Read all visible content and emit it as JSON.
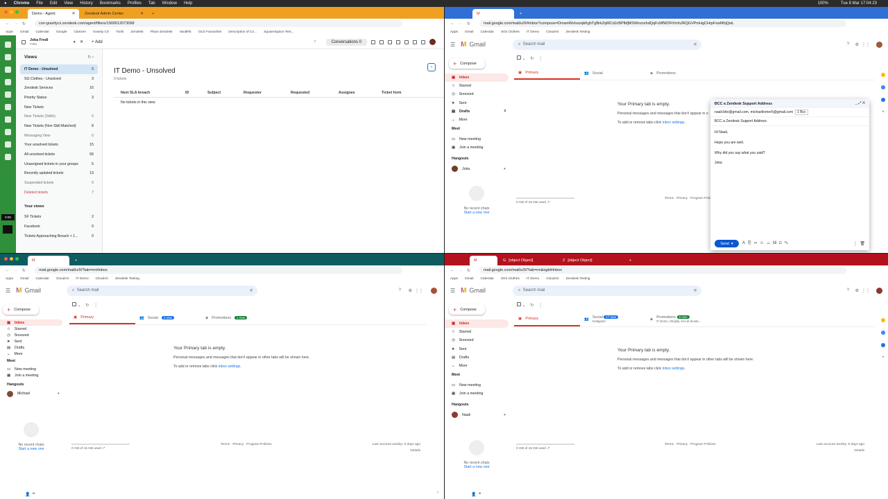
{
  "menubar": {
    "apple": "",
    "app": "Chrome",
    "items": [
      "File",
      "Edit",
      "View",
      "History",
      "Bookmarks",
      "Profiles",
      "Tab",
      "Window",
      "Help"
    ],
    "battery": "100%",
    "clock": "Tue 8 Mar 17:04:23"
  },
  "q1": {
    "tabs": [
      "Demo - Agent",
      "Zendesk Admin Center"
    ],
    "url": "con-gravitycx.zendesk.com/agent/filters/1900012073068",
    "bookmarks": [
      "Apps",
      "Gmail",
      "Calendar",
      "Google",
      "Clarizen",
      "Gravity CX",
      "Tools",
      "Zendesk",
      "Place Zendesk",
      "VaultRE",
      "OLD Favourites",
      "Description of Co...",
      "SquareSpace Test..."
    ],
    "user": {
      "name": "Joka Fredi",
      "id": "#485"
    },
    "add_label": "Add",
    "conversations_label": "Conversations",
    "conversations_count": "0",
    "views_title": "Views",
    "views": [
      {
        "label": "IT Demo - Unsolved",
        "count": "0"
      },
      {
        "label": "SG Clothes - Unsolved",
        "count": "3"
      },
      {
        "label": "Zendesk Services",
        "count": "16"
      },
      {
        "label": "Priority Status",
        "count": "3"
      },
      {
        "label": "New Tickets",
        "count": ""
      },
      {
        "label": "New Tickets (Skills)",
        "count": "0"
      },
      {
        "label": "New Tickets (Non Skill Matched)",
        "count": "8"
      },
      {
        "label": "Messaging View",
        "count": "0"
      },
      {
        "label": "Your unsolved tickets",
        "count": "15"
      },
      {
        "label": "All unsolved tickets",
        "count": "56"
      },
      {
        "label": "Unassigned tickets in your groups",
        "count": "5"
      },
      {
        "label": "Recently updated tickets",
        "count": "13"
      },
      {
        "label": "Suspended tickets",
        "count": "0"
      },
      {
        "label": "Deleted tickets",
        "count": "7"
      }
    ],
    "your_views_title": "Your views",
    "your_views": [
      {
        "label": "SF Tickets",
        "count": "2"
      },
      {
        "label": "Facebook",
        "count": "0"
      },
      {
        "label": "Tickets Approaching Breach < 1...",
        "count": "0"
      }
    ],
    "page_title": "IT Demo - Unsolved",
    "ticket_count": "0 tickets",
    "columns": [
      "Next SLA breach",
      "ID",
      "Subject",
      "Requester",
      "Requested",
      "Assignee",
      "Ticket form"
    ],
    "empty_row": "No tickets in this view",
    "timer": "0:00"
  },
  "q2": {
    "url": "mail.google.com/mail/u/0/#inbox?compose=DmwnWsIvszqkKghTgBrkZqMCdJcBPfbfjMSWnzxxhdQqFcMfW2FtVmhJRQGVPmHgCHrpFxwMhjQwL",
    "bookmarks": [
      "Apps",
      "Gmail",
      "Calendar",
      "SGs Clothes",
      "IT Demo",
      "CloudAir",
      "Zendesk Testing"
    ],
    "search_placeholder": "Search mail",
    "compose_label": "Compose",
    "nav": [
      {
        "label": "Inbox",
        "count": ""
      },
      {
        "label": "Starred",
        "count": ""
      },
      {
        "label": "Snoozed",
        "count": ""
      },
      {
        "label": "Sent",
        "count": ""
      },
      {
        "label": "Drafts",
        "count": "3"
      },
      {
        "label": "More",
        "count": ""
      }
    ],
    "meet_title": "Meet",
    "meet": [
      "New meeting",
      "Join a meeting"
    ],
    "hangouts_title": "Hangouts",
    "hangouts_user": "Joka",
    "no_chats": "No recent chats",
    "start_new": "Start a new one",
    "tabs": [
      "Primary",
      "Social",
      "Promotions"
    ],
    "empty_title": "Your Primary tab is empty.",
    "empty_line1": "Personal messages and messages that don't appear in o",
    "empty_line2_pre": "To add or remove tabs click ",
    "empty_link": "inbox settings",
    "empty_line2_post": ".",
    "storage": "0 GB of 15 GB used",
    "footer": "Terms · Privacy · Program Polic",
    "compose_window": {
      "title": "BCC a Zendesk Support Address",
      "recipients": "naali.bito@gmail.com, michaellomer5@gmail.com",
      "bcc_tag": "1 Bcc",
      "subject": "BCC a Zendesk Support Address",
      "body": [
        "Hi Naali,",
        "Hope you are well.",
        "Why did you say what you said?",
        "Joka"
      ],
      "send_label": "Send"
    }
  },
  "q3": {
    "url": "mail.google.com/mail/u/0/?tab=rm#inbox",
    "bookmarks": [
      "Apps",
      "Gmail",
      "Calendar",
      "CloudAir",
      "IT Demo",
      "CloudAir",
      "Zendesk Testing"
    ],
    "search_placeholder": "Search mail",
    "compose_label": "Compose",
    "nav": [
      {
        "label": "Inbox"
      },
      {
        "label": "Starred"
      },
      {
        "label": "Snoozed"
      },
      {
        "label": "Sent"
      },
      {
        "label": "Drafts"
      },
      {
        "label": "More"
      }
    ],
    "meet_title": "Meet",
    "meet": [
      "New meeting",
      "Join a meeting"
    ],
    "hangouts_title": "Hangouts",
    "hangouts_user": "Michael",
    "no_chats": "No recent chats",
    "start_new": "Start a new one",
    "tabs": [
      {
        "label": "Primary",
        "badge": ""
      },
      {
        "label": "Social",
        "badge": "2 new"
      },
      {
        "label": "Promotions",
        "badge": "1 new"
      }
    ],
    "empty_title": "Your Primary tab is empty.",
    "empty_line1": "Personal messages and messages that don't appear in other tabs will be shown here.",
    "empty_line2_pre": "To add or remove tabs click ",
    "empty_link": "inbox settings",
    "empty_line2_post": ".",
    "storage": "0 GB of 15 GB used",
    "footer": "Terms · Privacy · Program Policies",
    "activity": "Last account activity: 6 days ago",
    "details": "Details"
  },
  "q4": {
    "tabs": [
      {
        "label": "Primary",
        "badge": "",
        "sub": ""
      },
      {
        "label": "Social",
        "badge": "17 new",
        "sub": "Instagram"
      },
      {
        "label": "Promotions",
        "badge": "6 new",
        "sub": "IT Demo, Shopify, Ans at Zende..."
      }
    ],
    "url": "mail.google.com/mail/u/0/?tab=rm&ogbl#inbox",
    "bookmarks": [
      "Apps",
      "Gmail",
      "Calendar",
      "SGs Clothes",
      "IT Demo",
      "CloudAir",
      "Zendesk Testing"
    ],
    "search_placeholder": "Search mail",
    "compose_label": "Compose",
    "nav": [
      {
        "label": "Inbox"
      },
      {
        "label": "Starred"
      },
      {
        "label": "Snoozed"
      },
      {
        "label": "Sent"
      },
      {
        "label": "Drafts"
      },
      {
        "label": "More"
      }
    ],
    "meet_title": "Meet",
    "meet": [
      "New meeting",
      "Join a meeting"
    ],
    "hangouts_title": "Hangouts",
    "hangouts_user": "Naali",
    "no_chats": "No recent chats",
    "start_new": "Start a new one",
    "empty_title": "Your Primary tab is empty.",
    "empty_line1": "Personal messages and messages that don't appear in other tabs will be shown here.",
    "empty_line2_pre": "To add or remove tabs click ",
    "empty_link": "inbox settings",
    "empty_line2_post": ".",
    "storage": "0 GB of 15 GB used",
    "footer": "Terms · Privacy · Program Policies",
    "activity": "Last account activity: 6 days ago",
    "details": "Details"
  }
}
